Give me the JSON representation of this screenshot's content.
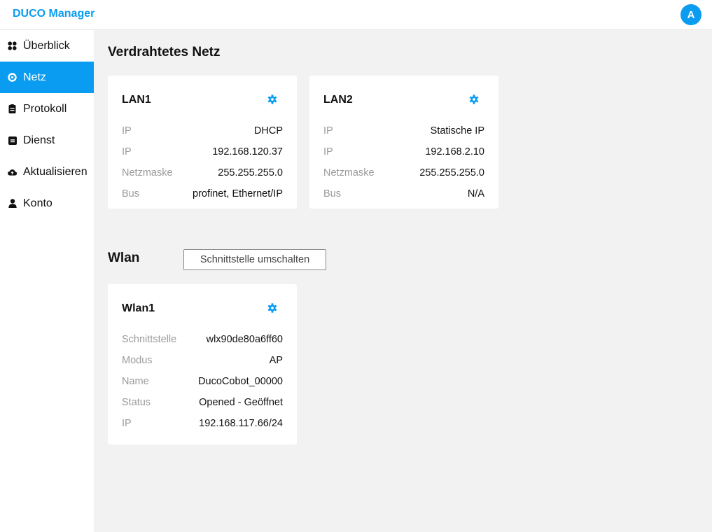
{
  "app": {
    "title": "DUCO Manager",
    "avatar_letter": "A",
    "accent": "#0a9cf0"
  },
  "sidebar": {
    "items": [
      {
        "label": "Überblick",
        "icon": "grid-icon",
        "active": false
      },
      {
        "label": "Netz",
        "icon": "network-icon",
        "active": true
      },
      {
        "label": "Protokoll",
        "icon": "clipboard-icon",
        "active": false
      },
      {
        "label": "Dienst",
        "icon": "service-icon",
        "active": false
      },
      {
        "label": "Aktualisieren",
        "icon": "cloud-upload-icon",
        "active": false
      },
      {
        "label": "Konto",
        "icon": "user-icon",
        "active": false
      }
    ]
  },
  "wired": {
    "title": "Verdrahtetes Netz",
    "cards": [
      {
        "title": "LAN1",
        "rows": [
          {
            "key": "IP",
            "value": "DHCP"
          },
          {
            "key": "IP",
            "value": "192.168.120.37"
          },
          {
            "key": "Netzmaske",
            "value": "255.255.255.0"
          },
          {
            "key": "Bus",
            "value": "profinet, Ethernet/IP"
          }
        ]
      },
      {
        "title": "LAN2",
        "rows": [
          {
            "key": "IP",
            "value": "Statische IP"
          },
          {
            "key": "IP",
            "value": "192.168.2.10"
          },
          {
            "key": "Netzmaske",
            "value": "255.255.255.0"
          },
          {
            "key": "Bus",
            "value": "N/A"
          }
        ]
      }
    ]
  },
  "wlan": {
    "title": "Wlan",
    "switch_button": "Schnittstelle umschalten",
    "cards": [
      {
        "title": "Wlan1",
        "rows": [
          {
            "key": "Schnittstelle",
            "value": "wlx90de80a6ff60"
          },
          {
            "key": "Modus",
            "value": "AP"
          },
          {
            "key": "Name",
            "value": "DucoCobot_00000"
          },
          {
            "key": "Status",
            "value": "Opened - Geöffnet"
          },
          {
            "key": "IP",
            "value": "192.168.117.66/24"
          }
        ]
      }
    ]
  }
}
